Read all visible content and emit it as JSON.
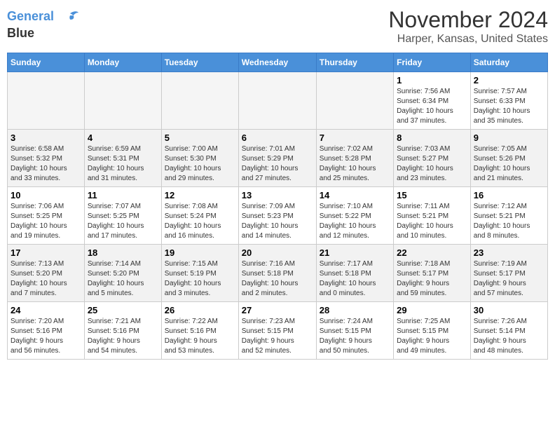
{
  "logo": {
    "line1": "General",
    "line2": "Blue"
  },
  "title": "November 2024",
  "location": "Harper, Kansas, United States",
  "weekdays": [
    "Sunday",
    "Monday",
    "Tuesday",
    "Wednesday",
    "Thursday",
    "Friday",
    "Saturday"
  ],
  "weeks": [
    [
      {
        "day": "",
        "detail": ""
      },
      {
        "day": "",
        "detail": ""
      },
      {
        "day": "",
        "detail": ""
      },
      {
        "day": "",
        "detail": ""
      },
      {
        "day": "",
        "detail": ""
      },
      {
        "day": "1",
        "detail": "Sunrise: 7:56 AM\nSunset: 6:34 PM\nDaylight: 10 hours\nand 37 minutes."
      },
      {
        "day": "2",
        "detail": "Sunrise: 7:57 AM\nSunset: 6:33 PM\nDaylight: 10 hours\nand 35 minutes."
      }
    ],
    [
      {
        "day": "3",
        "detail": "Sunrise: 6:58 AM\nSunset: 5:32 PM\nDaylight: 10 hours\nand 33 minutes."
      },
      {
        "day": "4",
        "detail": "Sunrise: 6:59 AM\nSunset: 5:31 PM\nDaylight: 10 hours\nand 31 minutes."
      },
      {
        "day": "5",
        "detail": "Sunrise: 7:00 AM\nSunset: 5:30 PM\nDaylight: 10 hours\nand 29 minutes."
      },
      {
        "day": "6",
        "detail": "Sunrise: 7:01 AM\nSunset: 5:29 PM\nDaylight: 10 hours\nand 27 minutes."
      },
      {
        "day": "7",
        "detail": "Sunrise: 7:02 AM\nSunset: 5:28 PM\nDaylight: 10 hours\nand 25 minutes."
      },
      {
        "day": "8",
        "detail": "Sunrise: 7:03 AM\nSunset: 5:27 PM\nDaylight: 10 hours\nand 23 minutes."
      },
      {
        "day": "9",
        "detail": "Sunrise: 7:05 AM\nSunset: 5:26 PM\nDaylight: 10 hours\nand 21 minutes."
      }
    ],
    [
      {
        "day": "10",
        "detail": "Sunrise: 7:06 AM\nSunset: 5:25 PM\nDaylight: 10 hours\nand 19 minutes."
      },
      {
        "day": "11",
        "detail": "Sunrise: 7:07 AM\nSunset: 5:25 PM\nDaylight: 10 hours\nand 17 minutes."
      },
      {
        "day": "12",
        "detail": "Sunrise: 7:08 AM\nSunset: 5:24 PM\nDaylight: 10 hours\nand 16 minutes."
      },
      {
        "day": "13",
        "detail": "Sunrise: 7:09 AM\nSunset: 5:23 PM\nDaylight: 10 hours\nand 14 minutes."
      },
      {
        "day": "14",
        "detail": "Sunrise: 7:10 AM\nSunset: 5:22 PM\nDaylight: 10 hours\nand 12 minutes."
      },
      {
        "day": "15",
        "detail": "Sunrise: 7:11 AM\nSunset: 5:21 PM\nDaylight: 10 hours\nand 10 minutes."
      },
      {
        "day": "16",
        "detail": "Sunrise: 7:12 AM\nSunset: 5:21 PM\nDaylight: 10 hours\nand 8 minutes."
      }
    ],
    [
      {
        "day": "17",
        "detail": "Sunrise: 7:13 AM\nSunset: 5:20 PM\nDaylight: 10 hours\nand 7 minutes."
      },
      {
        "day": "18",
        "detail": "Sunrise: 7:14 AM\nSunset: 5:20 PM\nDaylight: 10 hours\nand 5 minutes."
      },
      {
        "day": "19",
        "detail": "Sunrise: 7:15 AM\nSunset: 5:19 PM\nDaylight: 10 hours\nand 3 minutes."
      },
      {
        "day": "20",
        "detail": "Sunrise: 7:16 AM\nSunset: 5:18 PM\nDaylight: 10 hours\nand 2 minutes."
      },
      {
        "day": "21",
        "detail": "Sunrise: 7:17 AM\nSunset: 5:18 PM\nDaylight: 10 hours\nand 0 minutes."
      },
      {
        "day": "22",
        "detail": "Sunrise: 7:18 AM\nSunset: 5:17 PM\nDaylight: 9 hours\nand 59 minutes."
      },
      {
        "day": "23",
        "detail": "Sunrise: 7:19 AM\nSunset: 5:17 PM\nDaylight: 9 hours\nand 57 minutes."
      }
    ],
    [
      {
        "day": "24",
        "detail": "Sunrise: 7:20 AM\nSunset: 5:16 PM\nDaylight: 9 hours\nand 56 minutes."
      },
      {
        "day": "25",
        "detail": "Sunrise: 7:21 AM\nSunset: 5:16 PM\nDaylight: 9 hours\nand 54 minutes."
      },
      {
        "day": "26",
        "detail": "Sunrise: 7:22 AM\nSunset: 5:16 PM\nDaylight: 9 hours\nand 53 minutes."
      },
      {
        "day": "27",
        "detail": "Sunrise: 7:23 AM\nSunset: 5:15 PM\nDaylight: 9 hours\nand 52 minutes."
      },
      {
        "day": "28",
        "detail": "Sunrise: 7:24 AM\nSunset: 5:15 PM\nDaylight: 9 hours\nand 50 minutes."
      },
      {
        "day": "29",
        "detail": "Sunrise: 7:25 AM\nSunset: 5:15 PM\nDaylight: 9 hours\nand 49 minutes."
      },
      {
        "day": "30",
        "detail": "Sunrise: 7:26 AM\nSunset: 5:14 PM\nDaylight: 9 hours\nand 48 minutes."
      }
    ]
  ]
}
